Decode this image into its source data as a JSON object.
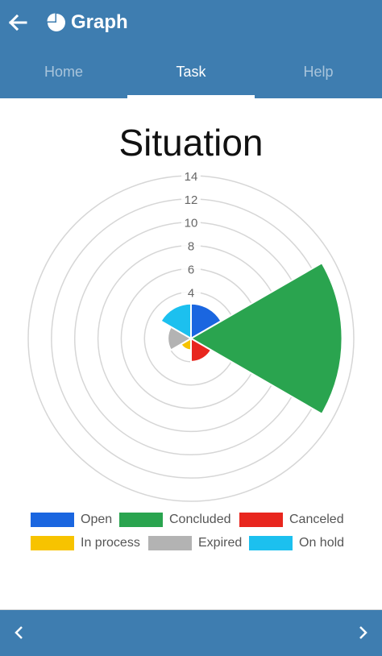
{
  "header": {
    "title": "Graph",
    "back_icon": "arrow-left-icon",
    "app_icon": "pie-chart-icon",
    "background": "#3e7db0"
  },
  "tabs": [
    {
      "label": "Home",
      "active": false
    },
    {
      "label": "Task",
      "active": true
    },
    {
      "label": "Help",
      "active": false
    }
  ],
  "footer": {
    "prev_icon": "chevron-left-icon",
    "next_icon": "chevron-right-icon"
  },
  "chart_data": {
    "type": "polar-area",
    "title": "Situation",
    "r_ticks": [
      "4",
      "6",
      "8",
      "10",
      "12",
      "14"
    ],
    "r_max": 14,
    "grid": true,
    "legend_position": "bottom",
    "categories": [
      "Open",
      "Concluded",
      "Canceled",
      "In process",
      "Expired",
      "On hold"
    ],
    "values": [
      3,
      13,
      2,
      1,
      2,
      3
    ],
    "colors": [
      "#1a66e0",
      "#2aa44f",
      "#e8261e",
      "#f7c300",
      "#b3b3b3",
      "#1cc0ef"
    ]
  }
}
